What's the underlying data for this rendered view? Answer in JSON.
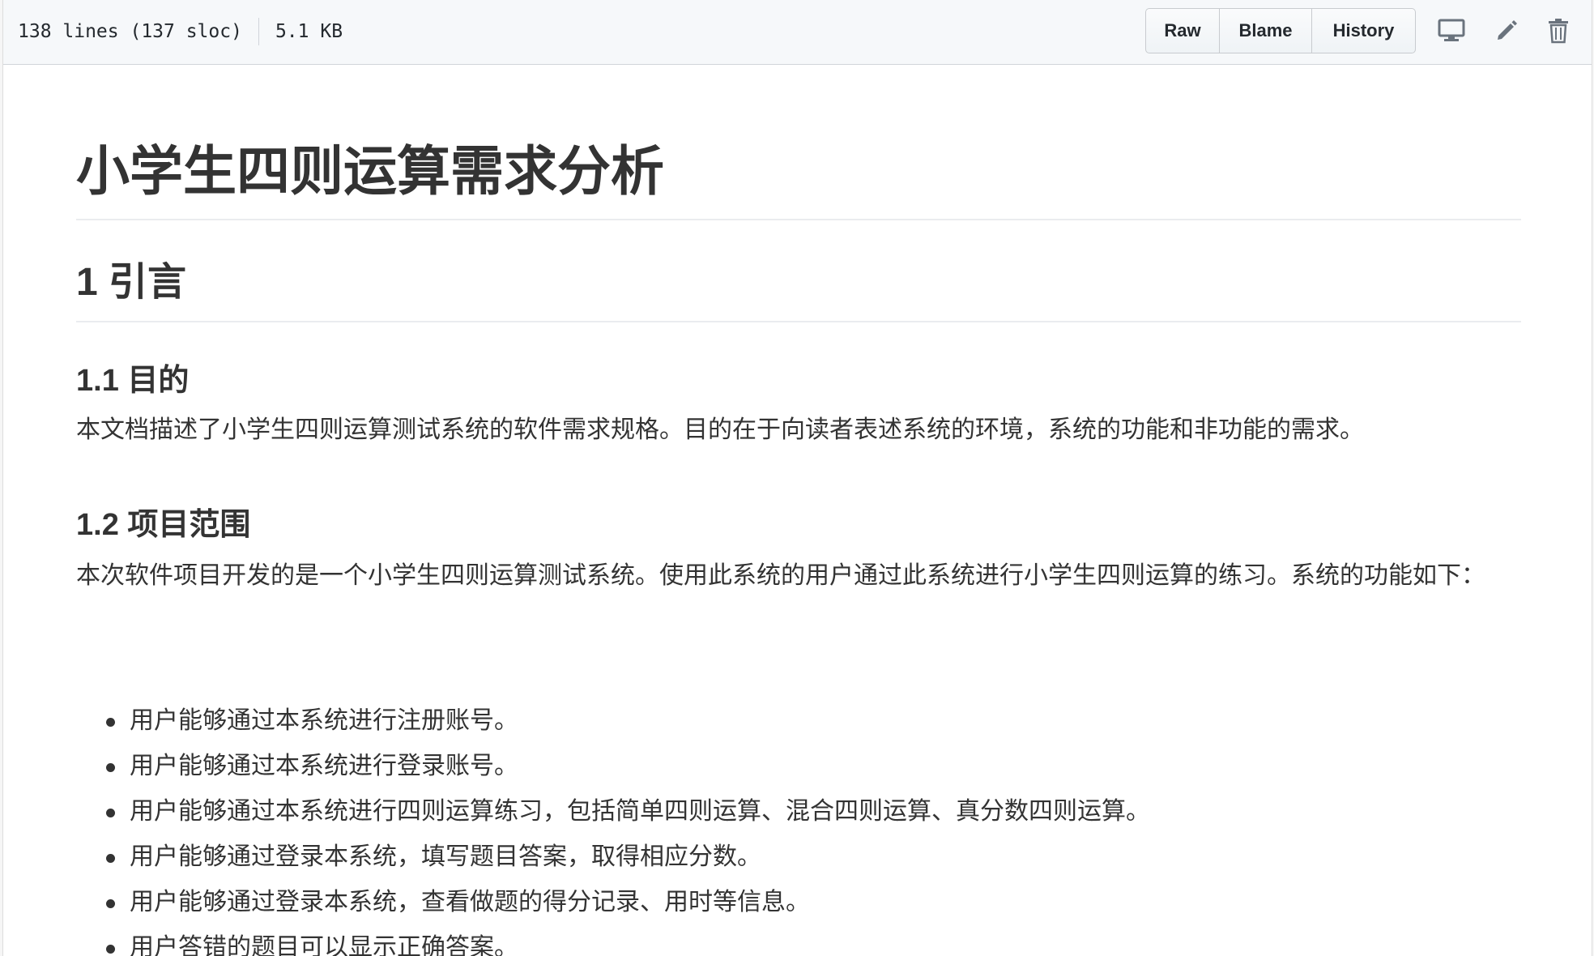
{
  "file_header": {
    "lines": "138 lines (137 sloc)",
    "size": "5.1 KB",
    "buttons": {
      "raw": "Raw",
      "blame": "Blame",
      "history": "History"
    },
    "icons": [
      "desktop-icon",
      "pencil-icon",
      "trash-icon"
    ]
  },
  "document": {
    "title": "小学生四则运算需求分析",
    "section_1": {
      "heading": "1 引言",
      "sub_1": {
        "heading": "1.1 目的",
        "text": "本文档描述了小学生四则运算测试系统的软件需求规格。目的在于向读者表述系统的环境，系统的功能和非功能的需求。"
      },
      "sub_2": {
        "heading": "1.2 项目范围",
        "text": "本次软件项目开发的是一个小学生四则运算测试系统。使用此系统的用户通过此系统进行小学生四则运算的练习。系统的功能如下：",
        "items": [
          "用户能够通过本系统进行注册账号。",
          "用户能够通过本系统进行登录账号。",
          "用户能够通过本系统进行四则运算练习，包括简单四则运算、混合四则运算、真分数四则运算。",
          "用户能够通过登录本系统，填写题目答案，取得相应分数。",
          "用户能够通过登录本系统，查看做题的得分记录、用时等信息。",
          "用户答错的题目可以显示正确答案。"
        ]
      }
    }
  },
  "colors": {
    "text": "#333333",
    "header_bg": "#f6f8fa",
    "border": "#d1d5da",
    "icon": "#6a737d"
  }
}
